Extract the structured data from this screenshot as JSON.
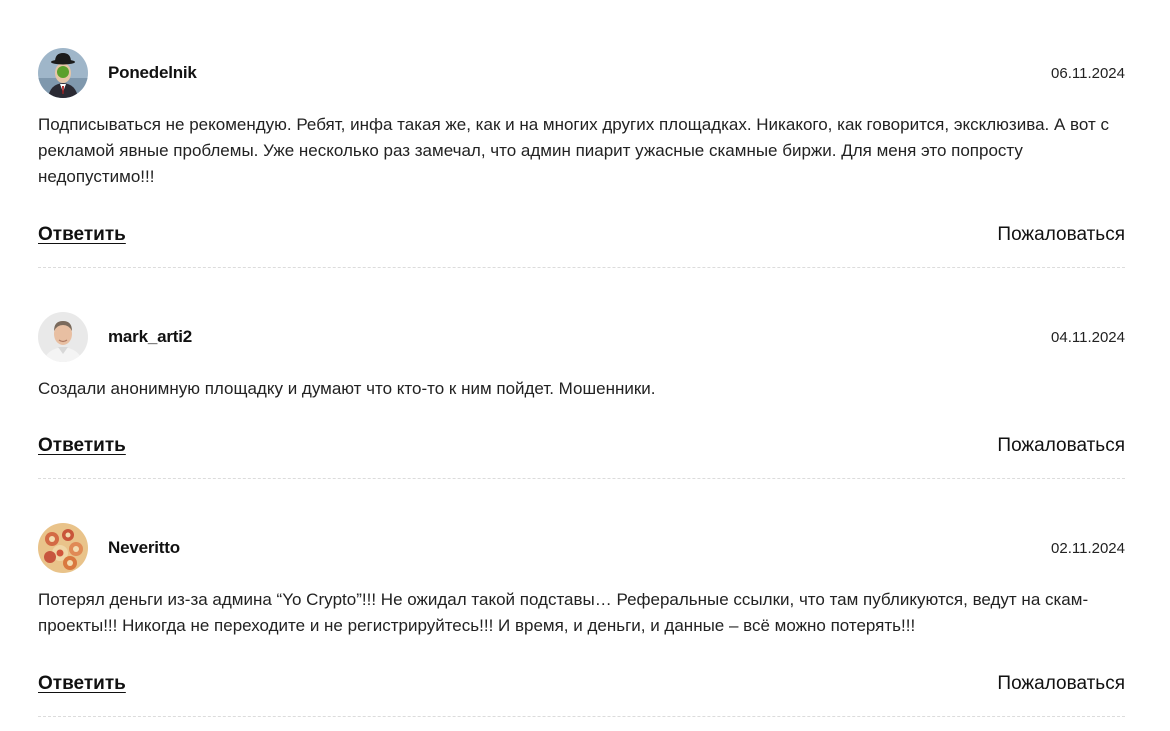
{
  "comments": [
    {
      "author": "Ponedelnik",
      "date": "06.11.2024",
      "avatar_icon": "bowler-hat-apple-face-avatar",
      "text": "Подписываться не рекомендую. Ребят, инфа такая же, как и на многих других площадках. Никакого, как говорится, эксклюзива. А вот с рекламой явные проблемы. Уже несколько раз замечал, что админ пиарит ужасные скамные биржи. Для меня это попросту недопустимо!!!",
      "reply_label": "Ответить",
      "complain_label": "Пожаловаться"
    },
    {
      "author": "mark_arti2",
      "date": "04.11.2024",
      "avatar_icon": "man-portrait-avatar",
      "text": "Создали анонимную площадку и думают что кто-то к ним пойдет. Мошенники.",
      "reply_label": "Ответить",
      "complain_label": "Пожаловаться"
    },
    {
      "author": "Neveritto",
      "date": "02.11.2024",
      "avatar_icon": "painted-figures-avatar",
      "text": "Потерял деньги из-за админа “Yo Crypto”!!! Не ожидал такой подставы… Реферальные ссылки, что там публикуются, ведут на скам-проекты!!! Никогда не переходите и не регистрируйтесь!!! И время, и деньги, и данные – всё можно потерять!!!",
      "reply_label": "Ответить",
      "complain_label": "Пожаловаться"
    }
  ],
  "colors": {
    "text": "#111111",
    "divider": "#dcdcdc",
    "background": "#ffffff"
  }
}
